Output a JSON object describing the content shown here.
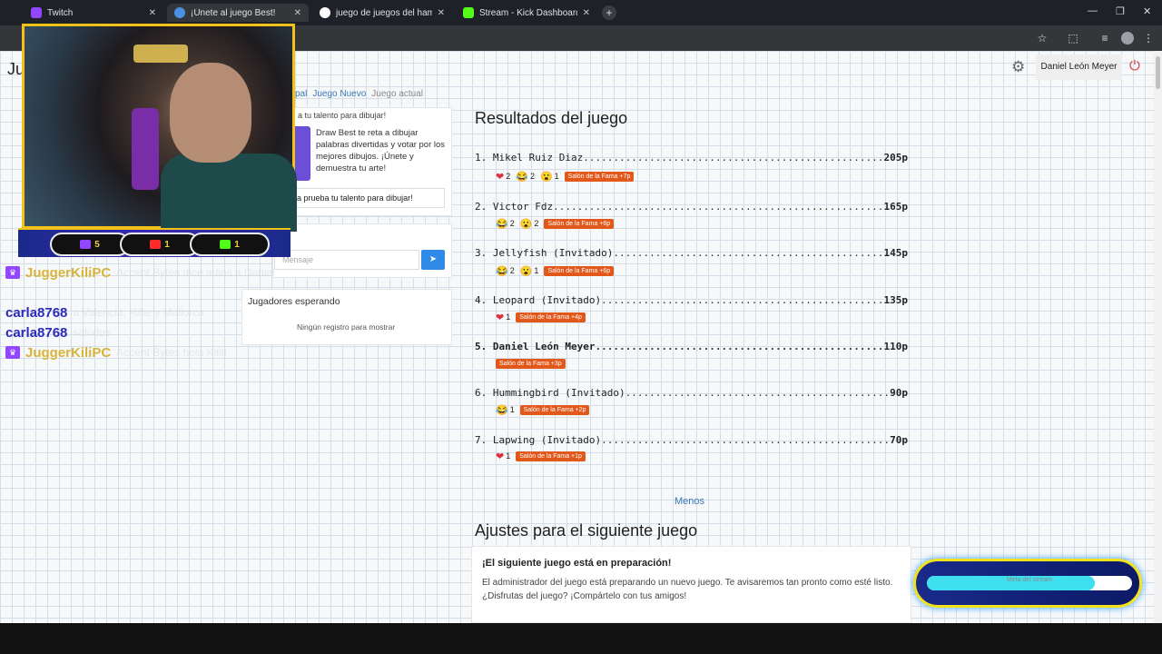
{
  "browser": {
    "tabs": [
      {
        "title": "Twitch",
        "color": "#9146ff"
      },
      {
        "title": "¡Únete al juego Best!",
        "color": "#4a90e2"
      },
      {
        "title": "juego de juegos del hambre - ",
        "color": "#4285f4"
      },
      {
        "title": "Stream - Kick Dashboard",
        "color": "#53fc18"
      }
    ],
    "new_tab": "+"
  },
  "page": {
    "heading": "Ju",
    "user_name": "Daniel León Meyer",
    "breadcrumb": {
      "first": "pal",
      "second": "Juego Nuevo",
      "current": "Juego actual"
    }
  },
  "sidebar": {
    "game_title": "a tu talento para dibujar!",
    "game_description": "Draw Best te reta a dibujar palabras divertidas y votar por los mejores dibujos. ¡Únete y demuestra tu arte!",
    "game_button": "a prueba tu talento para dibujar!",
    "chat_placeholder": "Mensaje",
    "waiting_title": "Jugadores esperando",
    "waiting_empty": "Ningún registro para mostrar"
  },
  "results": {
    "title": "Resultados del juego",
    "rows": [
      {
        "rank": "1.",
        "name": "Mikel Ruiz Diaz",
        "points": "205p",
        "reactions": [
          {
            "emoji": "heart",
            "count": "2"
          },
          {
            "emoji": "laugh",
            "count": "2"
          },
          {
            "emoji": "wow",
            "count": "1"
          }
        ],
        "fame": "Salón de la Fama +7p"
      },
      {
        "rank": "2.",
        "name": "Victor Fdz",
        "points": "165p",
        "reactions": [
          {
            "emoji": "laugh",
            "count": "2"
          },
          {
            "emoji": "wow",
            "count": "2"
          }
        ],
        "fame": "Salón de la Fama +6p"
      },
      {
        "rank": "3.",
        "name": "Jellyfish (Invitado)",
        "points": "145p",
        "reactions": [
          {
            "emoji": "laugh",
            "count": "2"
          },
          {
            "emoji": "wow",
            "count": "1"
          }
        ],
        "fame": "Salón de la Fama +6p"
      },
      {
        "rank": "4.",
        "name": "Leopard (Invitado)",
        "points": "135p",
        "reactions": [
          {
            "emoji": "heart",
            "count": "1"
          }
        ],
        "fame": "Salón de la Fama +4p"
      },
      {
        "rank": "5.",
        "name": "Daniel León Meyer",
        "points": "110p",
        "reactions": [],
        "fame": "Salón de la Fama +3p",
        "current_user": true
      },
      {
        "rank": "6.",
        "name": "Hummingbird (Invitado)",
        "points": "90p",
        "reactions": [
          {
            "emoji": "laugh",
            "count": "1"
          }
        ],
        "fame": "Salón de la Fama +2p"
      },
      {
        "rank": "7.",
        "name": "Lapwing (Invitado)",
        "points": "70p",
        "reactions": [
          {
            "emoji": "heart",
            "count": "1"
          }
        ],
        "fame": "Salón de la Fama +1p"
      }
    ],
    "less_link": "Menos"
  },
  "next_game": {
    "title": "Ajustes para el siguiente juego",
    "heading": "¡El siguiente juego está en preparación!",
    "body": "El administrador del juego está preparando un nuevo juego. Te avisaremos tan pronto como esté listo. ¿Disfrutas del juego? ¡Compártelo con tus amigos!"
  },
  "stream_overlay": {
    "counters": [
      {
        "platform": "twitch",
        "count": "5",
        "color": "#9146ff"
      },
      {
        "platform": "youtube",
        "count": "1",
        "color": "#ff2a2a"
      },
      {
        "platform": "kick",
        "count": "1",
        "color": "#53fc18"
      }
    ],
    "chat": [
      {
        "user": "JuggerKiliPC",
        "color": "#d8b43a",
        "badge": true,
        "message": "Accent Bytes dice adios a Daniel"
      },
      {
        "user": "carla8768",
        "color": "#2a2ab8",
        "badge": false,
        "message": "a Valencia, Ribe y Mallorca"
      },
      {
        "user": "carla8768",
        "color": "#2a2ab8",
        "badge": false,
        "message": "saludos"
      },
      {
        "user": "JuggerKiliPC",
        "color": "#d8b43a",
        "badge": true,
        "message": "Accent Bytes hola Kiliti"
      }
    ],
    "goal_label": "Meta del stream",
    "goal_progress": 0.82
  }
}
